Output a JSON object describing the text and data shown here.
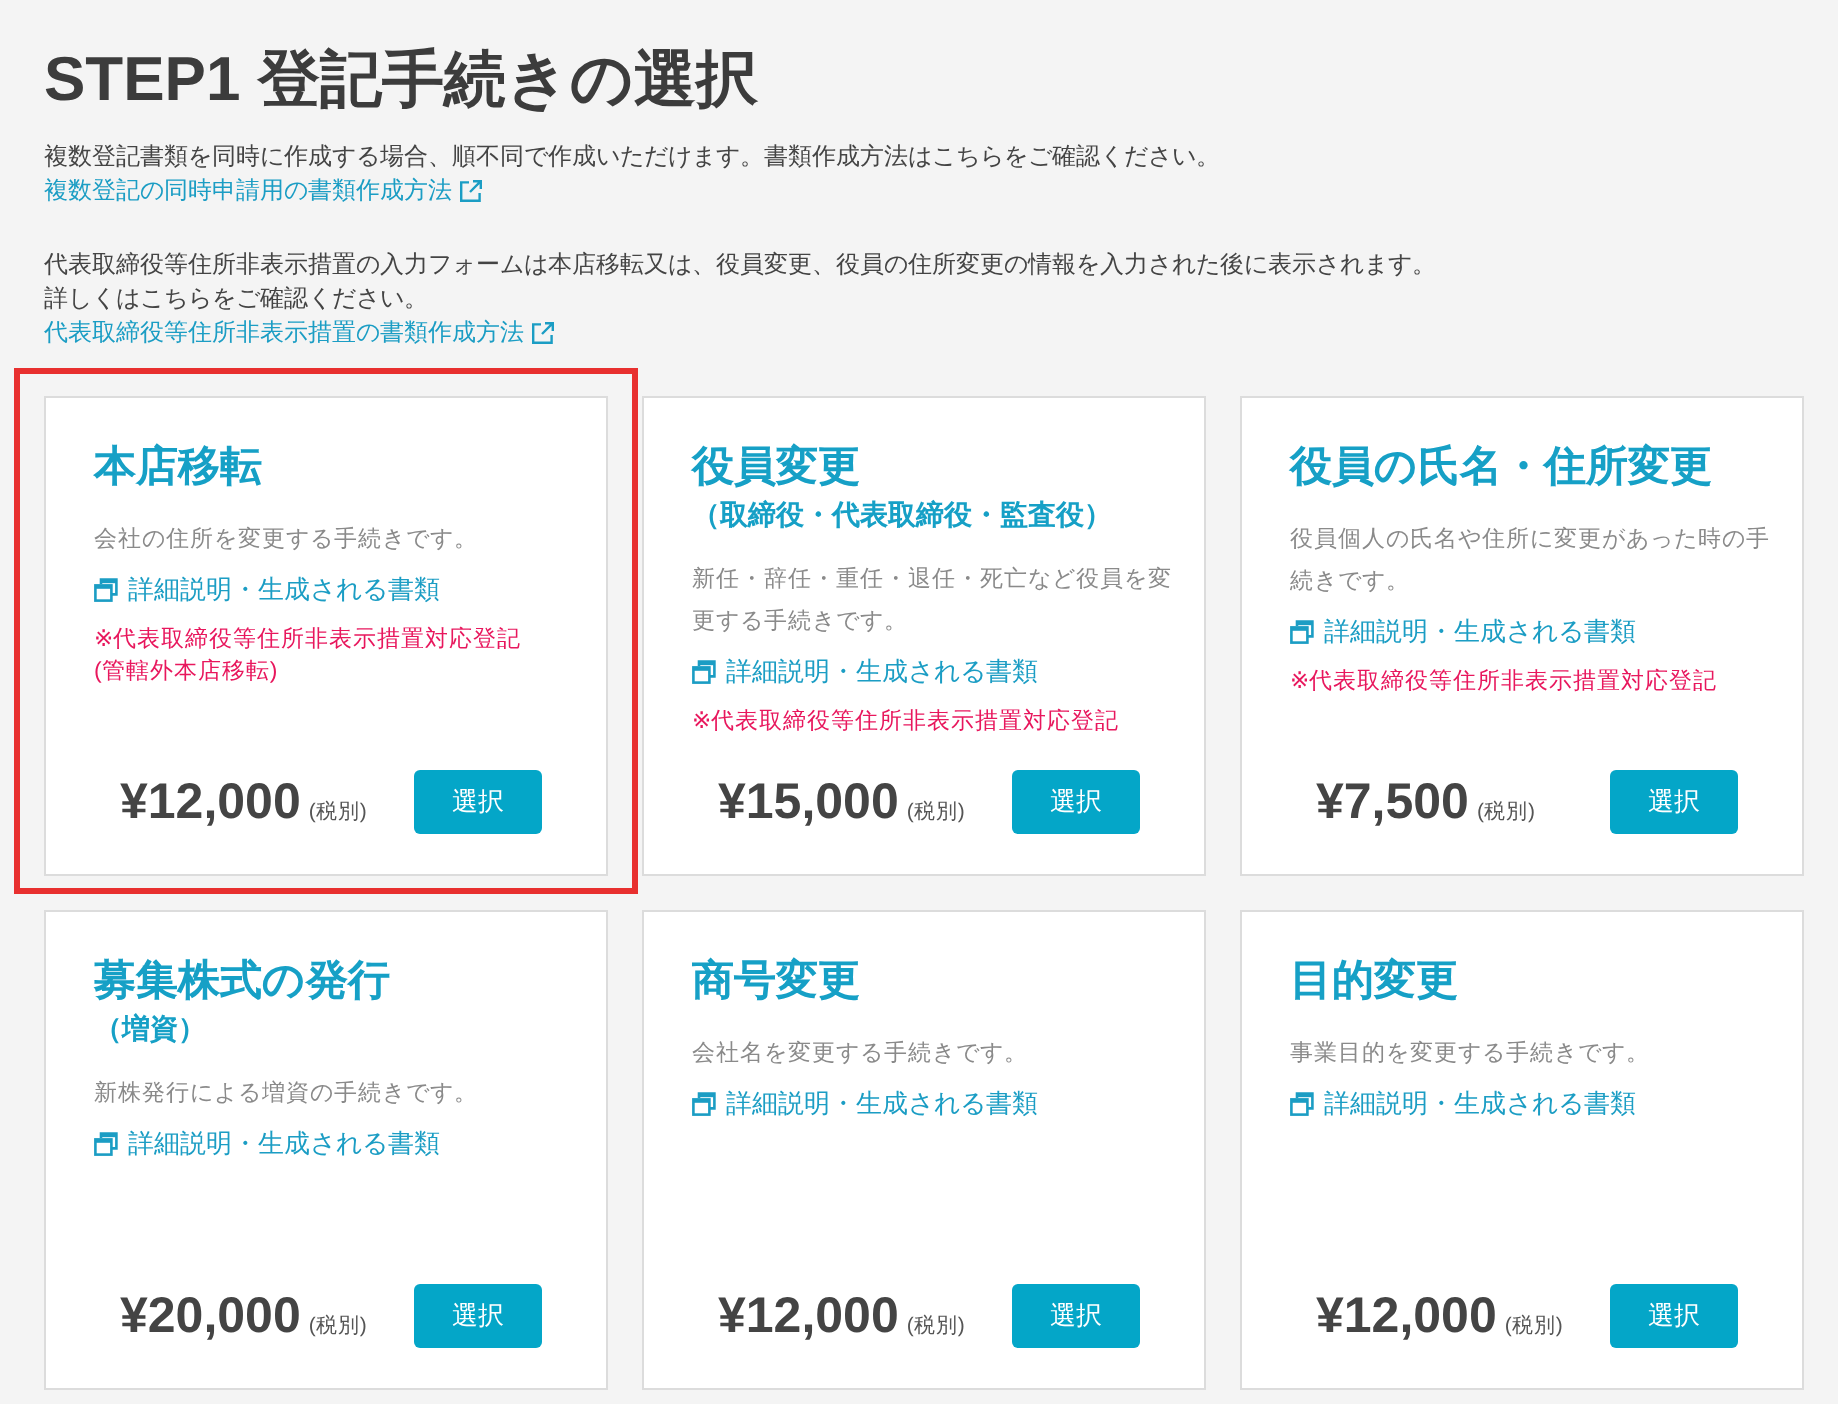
{
  "page": {
    "title": "STEP1 登記手続きの選択"
  },
  "notices": [
    {
      "lines": [
        "複数登記書類を同時に作成する場合、順不同で作成いただけます。書類作成方法はこちらをご確認ください。"
      ],
      "link": "複数登記の同時申請用の書類作成方法"
    },
    {
      "lines": [
        "代表取締役等住所非表示措置の入力フォームは本店移転又は、役員変更、役員の住所変更の情報を入力された後に表示されます。",
        "詳しくはこちらをご確認ください。"
      ],
      "link": "代表取締役等住所非表示措置の書類作成方法"
    }
  ],
  "procedures": [
    {
      "title": "本店移転",
      "description": "会社の住所を変更する手続きです。",
      "detail_link": "詳細説明・生成される書類",
      "notes": [
        "※代表取締役等住所非表示措置対応登記",
        "(管轄外本店移転)"
      ],
      "price": "¥12,000",
      "tax_note": "(税別)",
      "button": "選択",
      "highlighted": true
    },
    {
      "title": "役員変更",
      "subtitle": "（取締役・代表取締役・監査役）",
      "description": "新任・辞任・重任・退任・死亡など役員を変更する手続きです。",
      "detail_link": "詳細説明・生成される書類",
      "notes": [
        "※代表取締役等住所非表示措置対応登記"
      ],
      "price": "¥15,000",
      "tax_note": "(税別)",
      "button": "選択",
      "highlighted": false
    },
    {
      "title": "役員の氏名・住所変更",
      "description": "役員個人の氏名や住所に変更があった時の手続きです。",
      "detail_link": "詳細説明・生成される書類",
      "notes": [
        "※代表取締役等住所非表示措置対応登記"
      ],
      "price": "¥7,500",
      "tax_note": "(税別)",
      "button": "選択",
      "highlighted": false
    },
    {
      "title": "募集株式の発行",
      "subtitle": "（増資）",
      "description": "新株発行による増資の手続きです。",
      "detail_link": "詳細説明・生成される書類",
      "price": "¥20,000",
      "tax_note": "(税別)",
      "button": "選択",
      "highlighted": false
    },
    {
      "title": "商号変更",
      "description": "会社名を変更する手続きです。",
      "detail_link": "詳細説明・生成される書類",
      "price": "¥12,000",
      "tax_note": "(税別)",
      "button": "選択",
      "highlighted": false
    },
    {
      "title": "目的変更",
      "description": "事業目的を変更する手続きです。",
      "detail_link": "詳細説明・生成される書類",
      "price": "¥12,000",
      "tax_note": "(税別)",
      "button": "選択",
      "highlighted": false
    }
  ]
}
